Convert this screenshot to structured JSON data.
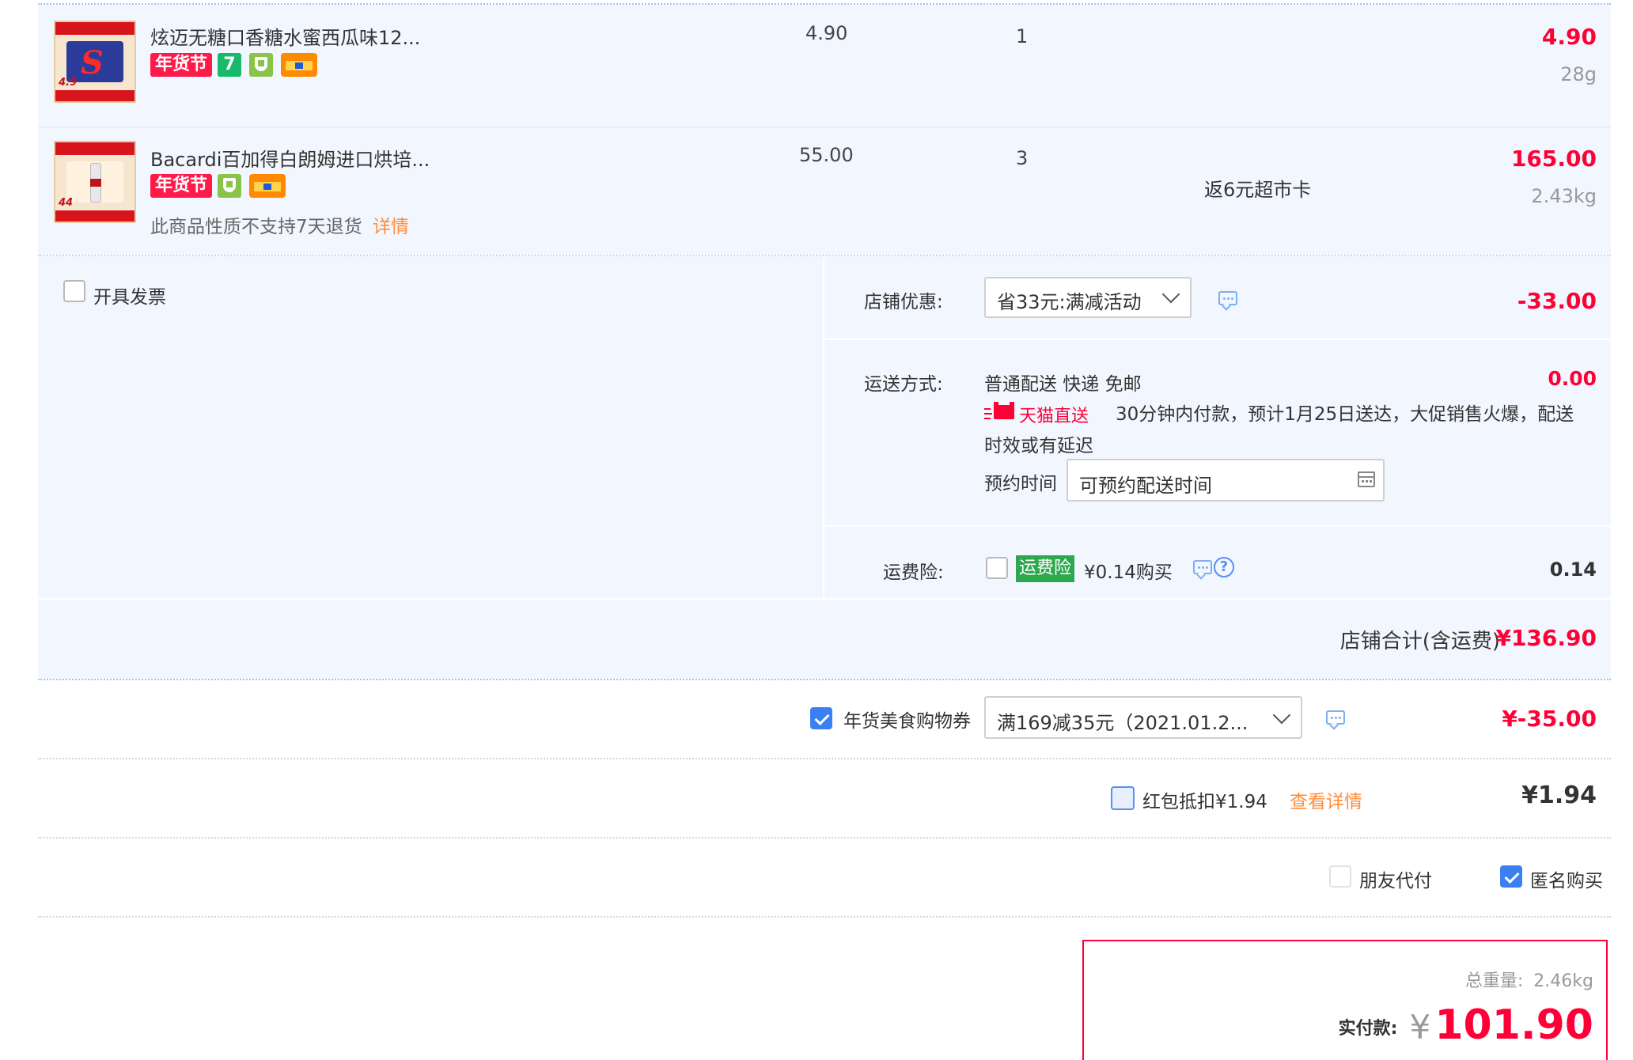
{
  "items": [
    {
      "name": "炫迈无糖口香糖水蜜西瓜味12...",
      "unit_price": "4.90",
      "qty": "1",
      "subtotal": "4.90",
      "weight": "28g",
      "thumb_price": "4.9",
      "tags": [
        "年货节",
        "7",
        "shield",
        "card"
      ]
    },
    {
      "name": "Bacardi百加得白朗姆进口烘培...",
      "unit_price": "55.00",
      "qty": "3",
      "subtotal": "165.00",
      "weight": "2.43kg",
      "promo": "返6元超市卡",
      "notice": "此商品性质不支持7天退货",
      "notice_link": "详情",
      "thumb_price": "44",
      "tags": [
        "年货节",
        "shield",
        "card"
      ]
    }
  ],
  "invoice": {
    "label": "开具发票"
  },
  "shop_discount": {
    "label": "店铺优惠:",
    "selected": "省33元:满减活动",
    "amount": "-33.00"
  },
  "shipping": {
    "label": "运送方式:",
    "method": "普通配送 快递 免邮",
    "amount": "0.00",
    "badge": "天猫直送",
    "note_line1": "30分钟内付款，预计1月25日送达，大促销售火爆，配送",
    "note_line2": "时效或有延迟",
    "schedule_label": "预约时间",
    "schedule_placeholder": "可预约配送时间"
  },
  "insurance": {
    "label": "运费险:",
    "badge": "运费险",
    "text": "¥0.14购买",
    "amount": "0.14"
  },
  "shop_total": {
    "label": "店铺合计(含运费)",
    "amount": "¥136.90"
  },
  "coupon": {
    "label": "年货美食购物券",
    "selected": "满169减35元（2021.01.2...",
    "amount": "¥-35.00",
    "checked": true
  },
  "red_packet": {
    "label": "红包抵扣¥1.94",
    "link": "查看详情",
    "amount": "¥1.94"
  },
  "options": {
    "friend_pay": "朋友代付",
    "anonymous": "匿名购买"
  },
  "summary": {
    "weight_label": "总重量:",
    "weight_value": "2.46kg",
    "pay_label": "实付款:",
    "currency": "¥",
    "pay_amount": "101.90"
  },
  "colors": {
    "price_red": "#ff0036",
    "accent_blue": "#3b7ff5",
    "panel_bg": "#f2f7ff"
  }
}
